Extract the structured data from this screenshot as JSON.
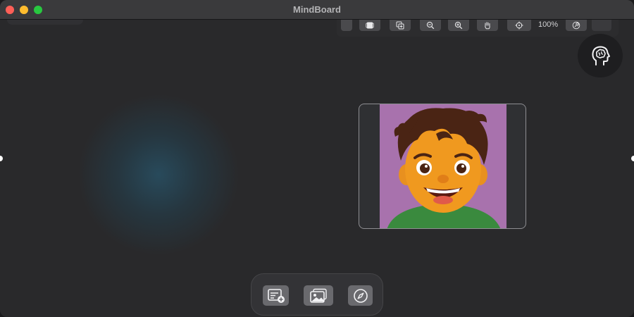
{
  "window": {
    "title": "MindBoard"
  },
  "toolbar": {
    "zoom_level": "100%",
    "buttons": [
      "frame-icon",
      "add-frame-icon",
      "zoom-out-icon",
      "zoom-in-icon",
      "hand-icon",
      "crosshair-icon",
      "link-icon"
    ]
  },
  "assistant": {
    "icon": "brain-head-icon"
  },
  "canvas": {
    "image_card": {
      "icon": "cartoon-boy-avatar"
    }
  },
  "dock": {
    "buttons": [
      "add-note-icon",
      "images-icon",
      "compass-icon"
    ]
  },
  "colors": {
    "background": "#29292b",
    "titlebar": "#3a3a3c",
    "avatar_bg": "#a872ad",
    "close": "#ff5f57",
    "minimize": "#febc2e",
    "maximize": "#28c840"
  }
}
